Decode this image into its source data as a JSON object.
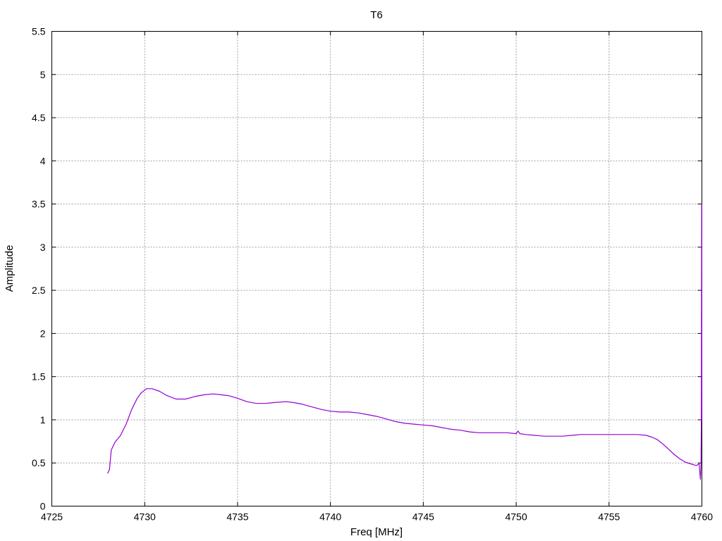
{
  "chart_data": {
    "type": "line",
    "title": "T6",
    "xlabel": "Freq [MHz]",
    "ylabel": "Amplitude",
    "xlim": [
      4725,
      4760
    ],
    "ylim": [
      0,
      5.5
    ],
    "xticks": [
      "4725",
      "4730",
      "4735",
      "4740",
      "4745",
      "4750",
      "4755",
      "4760"
    ],
    "yticks": [
      "0",
      "0.5",
      "1",
      "1.5",
      "2",
      "2.5",
      "3",
      "3.5",
      "4",
      "4.5",
      "5",
      "5.5"
    ],
    "grid": true,
    "series": [
      {
        "color": "#9400d3",
        "x": [
          4728.0,
          4728.1,
          4728.2,
          4728.4,
          4728.7,
          4729.0,
          4729.3,
          4729.6,
          4729.8,
          4730.1,
          4730.4,
          4730.8,
          4731.2,
          4731.7,
          4732.2,
          4732.7,
          4733.2,
          4733.7,
          4734.1,
          4734.5,
          4735.0,
          4735.5,
          4736.0,
          4736.5,
          4737.0,
          4737.6,
          4738.0,
          4738.5,
          4739.0,
          4739.5,
          4740.0,
          4740.5,
          4741.0,
          4741.5,
          4742.0,
          4742.5,
          4743.0,
          4743.5,
          4744.0,
          4744.5,
          4745.0,
          4745.5,
          4746.0,
          4746.5,
          4747.0,
          4747.5,
          4748.0,
          4748.5,
          4749.0,
          4749.5,
          4750.0,
          4750.1,
          4750.2,
          4750.5,
          4751.0,
          4751.5,
          4752.0,
          4752.5,
          4753.0,
          4753.5,
          4754.0,
          4754.5,
          4755.0,
          4755.5,
          4756.0,
          4756.5,
          4757.0,
          4757.3,
          4757.6,
          4757.9,
          4758.2,
          4758.5,
          4758.8,
          4759.1,
          4759.4,
          4759.7,
          4759.85,
          4759.92,
          4759.95,
          4759.97,
          4759.99,
          4760.0
        ],
        "y": [
          0.38,
          0.42,
          0.65,
          0.74,
          0.82,
          0.95,
          1.12,
          1.25,
          1.31,
          1.36,
          1.36,
          1.33,
          1.28,
          1.24,
          1.24,
          1.27,
          1.29,
          1.3,
          1.29,
          1.28,
          1.25,
          1.21,
          1.19,
          1.19,
          1.2,
          1.21,
          1.2,
          1.18,
          1.15,
          1.12,
          1.1,
          1.09,
          1.09,
          1.08,
          1.06,
          1.04,
          1.01,
          0.98,
          0.96,
          0.95,
          0.94,
          0.93,
          0.91,
          0.89,
          0.88,
          0.86,
          0.85,
          0.85,
          0.85,
          0.85,
          0.84,
          0.87,
          0.84,
          0.83,
          0.82,
          0.81,
          0.81,
          0.81,
          0.82,
          0.83,
          0.83,
          0.83,
          0.83,
          0.83,
          0.83,
          0.83,
          0.82,
          0.8,
          0.77,
          0.72,
          0.66,
          0.6,
          0.55,
          0.51,
          0.49,
          0.47,
          0.49,
          0.31,
          0.48,
          1.0,
          3.5,
          1.0
        ]
      }
    ]
  }
}
